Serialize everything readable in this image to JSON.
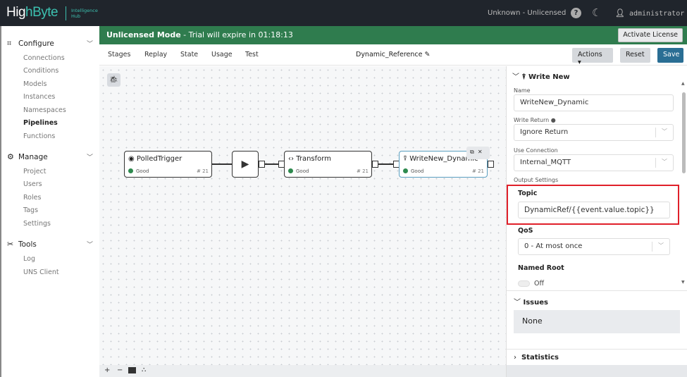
{
  "header": {
    "logo_main": "HighByte",
    "logo_sub_1": "Intelligence",
    "logo_sub_2": "Hub",
    "license": "Unknown - Unlicensed",
    "help_icon": "?",
    "user": "administrator"
  },
  "sidebar": {
    "sections": [
      {
        "label": "Configure",
        "icon": "nodes-icon",
        "items": [
          "Connections",
          "Conditions",
          "Models",
          "Instances",
          "Namespaces",
          "Pipelines",
          "Functions"
        ]
      },
      {
        "label": "Manage",
        "icon": "gear-icon",
        "items": [
          "Project",
          "Users",
          "Roles",
          "Tags",
          "Settings"
        ]
      },
      {
        "label": "Tools",
        "icon": "tools-icon",
        "items": [
          "Log",
          "UNS Client"
        ]
      }
    ],
    "active": "Pipelines"
  },
  "banner": {
    "mode": "Unlicensed Mode",
    "message": " - Trial will expire in 01:18:13",
    "button": "Activate License",
    "color": "#2f7c4e"
  },
  "toolbar": {
    "tabs": [
      "Stages",
      "Replay",
      "State",
      "Usage",
      "Test"
    ],
    "title": "Dynamic_Reference",
    "actions": "Actions ▾",
    "reset": "Reset",
    "save": "Save"
  },
  "pipeline": {
    "nodes": [
      {
        "name": "PolledTrigger",
        "status": "Good",
        "count": "# 21"
      },
      {
        "name": "Transform",
        "status": "Good",
        "count": "# 21"
      },
      {
        "name": "WriteNew_Dynamic",
        "status": "Good",
        "count": "# 21"
      }
    ]
  },
  "canvas_tools": [
    "+",
    "−",
    "minimap",
    "layout"
  ],
  "panel": {
    "title": "Write New",
    "name_label": "Name",
    "name_value": "WriteNew_Dynamic",
    "write_return_label": "Write Return",
    "write_return_value": "Ignore Return",
    "connection_label": "Use Connection",
    "connection_value": "Internal_MQTT",
    "output_label": "Output Settings",
    "topic_label": "Topic",
    "topic_value": "DynamicRef/{{event.value.topic}}",
    "qos_label": "QoS",
    "qos_value": "0 - At most once",
    "named_root_label": "Named Root",
    "named_root_value": "Off",
    "issues_label": "Issues",
    "issues_value": "None",
    "statistics_label": "Statistics"
  }
}
